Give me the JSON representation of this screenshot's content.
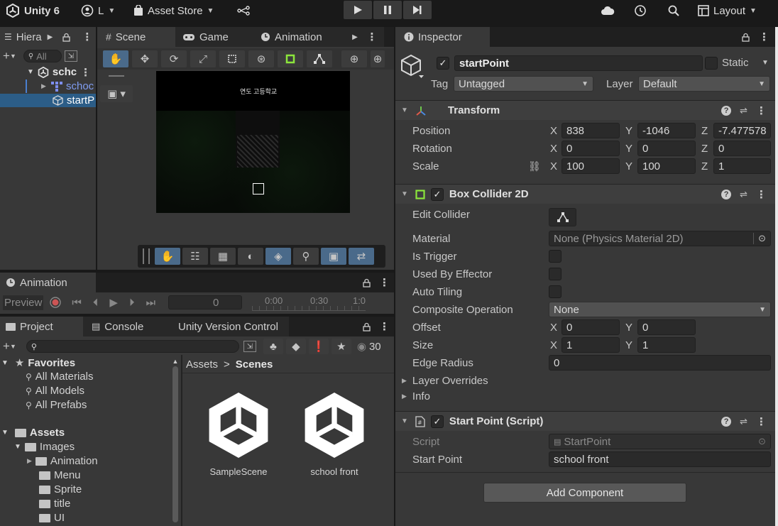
{
  "topbar": {
    "app_title": "Unity 6",
    "account": "L",
    "asset_store": "Asset Store",
    "layout": "Layout"
  },
  "hierarchy": {
    "tab": "Hiera",
    "search_placeholder": "All",
    "scene_name": "schc",
    "items": [
      {
        "label": "schoc"
      },
      {
        "label": "startP"
      }
    ]
  },
  "scene_view": {
    "tabs": [
      "Scene",
      "Game",
      "Animation"
    ],
    "sign_text": "연도 고등학교"
  },
  "animation": {
    "tab": "Animation",
    "preview_label": "Preview",
    "frame_value": "0",
    "timeline_ticks": [
      "0:00",
      "0:30",
      "1:0"
    ]
  },
  "project": {
    "tabs": [
      "Project",
      "Console",
      "Unity Version Control"
    ],
    "hidden_count": "30",
    "favorites_label": "Favorites",
    "favorites": [
      "All Materials",
      "All Models",
      "All Prefabs"
    ],
    "assets_label": "Assets",
    "tree": [
      "Images",
      "Animation",
      "Menu",
      "Sprite",
      "title",
      "UI"
    ],
    "breadcrumb": [
      "Assets",
      "Scenes"
    ],
    "files": [
      "SampleScene",
      "school front"
    ]
  },
  "inspector": {
    "tab": "Inspector",
    "object_name": "startPoint",
    "static_label": "Static",
    "tag_label": "Tag",
    "tag_value": "Untagged",
    "layer_label": "Layer",
    "layer_value": "Default",
    "transform": {
      "title": "Transform",
      "position_label": "Position",
      "rotation_label": "Rotation",
      "scale_label": "Scale",
      "position": {
        "x": "838",
        "y": "-1046",
        "z": "-7.477578"
      },
      "rotation": {
        "x": "0",
        "y": "0",
        "z": "0"
      },
      "scale": {
        "x": "100",
        "y": "100",
        "z": "1"
      }
    },
    "box_collider": {
      "title": "Box Collider 2D",
      "edit_collider": "Edit Collider",
      "material_label": "Material",
      "material_value": "None (Physics Material 2D)",
      "is_trigger": "Is Trigger",
      "used_by_effector": "Used By Effector",
      "auto_tiling": "Auto Tiling",
      "composite_label": "Composite Operation",
      "composite_value": "None",
      "offset_label": "Offset",
      "offset": {
        "x": "0",
        "y": "0"
      },
      "size_label": "Size",
      "size": {
        "x": "1",
        "y": "1"
      },
      "edge_radius_label": "Edge Radius",
      "edge_radius": "0",
      "layer_overrides": "Layer Overrides",
      "info": "Info"
    },
    "script_component": {
      "title": "Start Point (Script)",
      "script_label": "Script",
      "script_value": "StartPoint",
      "start_point_label": "Start Point",
      "start_point_value": "school front"
    },
    "add_component": "Add Component"
  },
  "axis_labels": {
    "x": "X",
    "y": "Y",
    "z": "Z"
  }
}
